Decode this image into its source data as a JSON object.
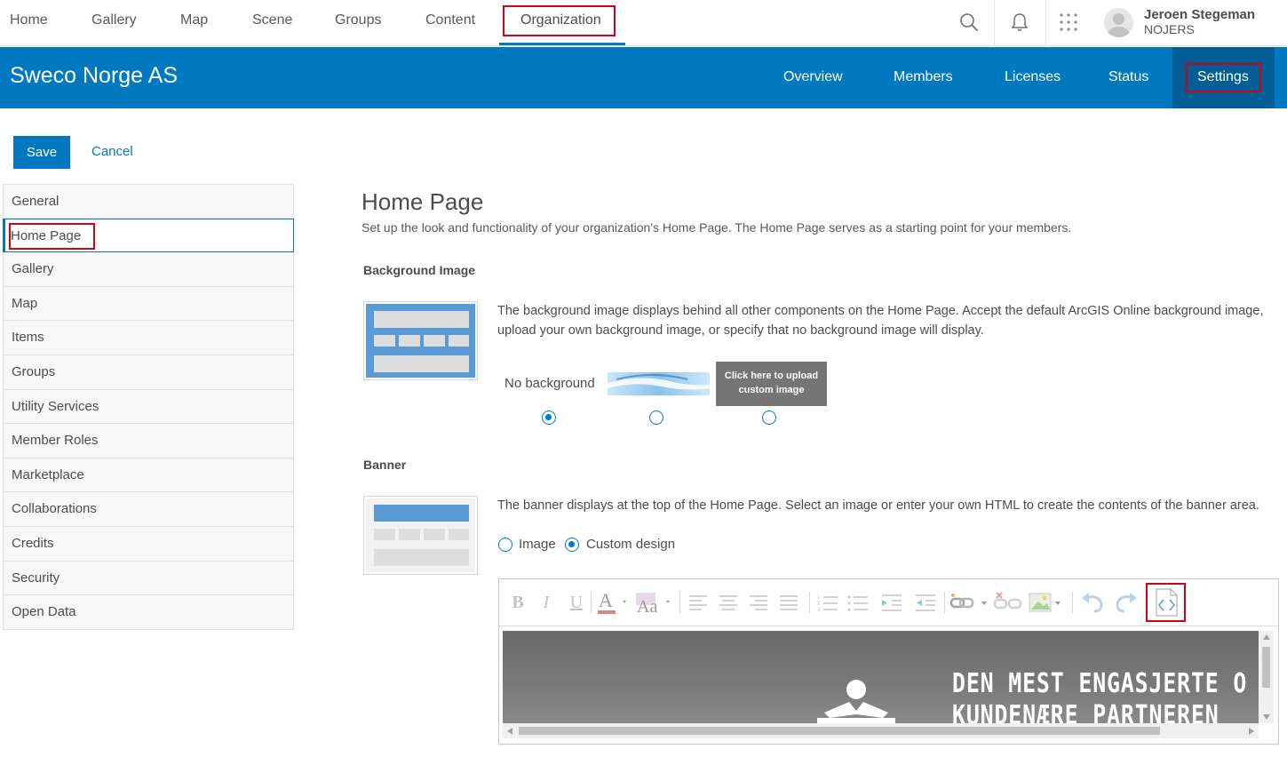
{
  "topnav": {
    "items": [
      "Home",
      "Gallery",
      "Map",
      "Scene",
      "Groups",
      "Content",
      "Organization"
    ],
    "active": "Organization"
  },
  "user": {
    "name": "Jeroen Stegeman",
    "org": "NOJERS"
  },
  "org_header": {
    "name": "Sweco Norge AS",
    "tabs": [
      "Overview",
      "Members",
      "Licenses",
      "Status",
      "Settings"
    ],
    "active_tab": "Settings"
  },
  "actions": {
    "save": "Save",
    "cancel": "Cancel"
  },
  "sidebar": {
    "items": [
      "General",
      "Home Page",
      "Gallery",
      "Map",
      "Items",
      "Groups",
      "Utility Services",
      "Member Roles",
      "Marketplace",
      "Collaborations",
      "Credits",
      "Security",
      "Open Data"
    ],
    "active": "Home Page"
  },
  "main": {
    "title": "Home Page",
    "description": "Set up the look and functionality of your organization's Home Page. The Home Page serves as a starting point for your members.",
    "background": {
      "title": "Background Image",
      "description": "The background image displays behind all other components on the Home Page. Accept the default ArcGIS Online background image, upload your own background image, or specify that no background image will display.",
      "no_background": "No background",
      "upload": "Click here to upload custom image",
      "selected": "No background"
    },
    "banner": {
      "title": "Banner",
      "description": "The banner displays at the top of the Home Page. Select an image or enter your own HTML to create the contents of the banner area.",
      "option_image": "Image",
      "option_custom": "Custom design",
      "selected": "Custom design",
      "preview_text_line1": "DEN MEST ENGASJERTE O",
      "preview_text_line2": "KUNDENÆRE PARTNEREN"
    }
  },
  "colors": {
    "brand_blue": "#0079c1",
    "dark_blue": "#005e95",
    "highlight_red": "#d0021b"
  },
  "toolbar_icons": [
    "bold-icon",
    "italic-icon",
    "underline-icon",
    "font-color-icon",
    "background-color-icon",
    "align-left-icon",
    "align-center-icon",
    "align-right-icon",
    "justify-icon",
    "numbered-list-icon",
    "bullet-list-icon",
    "indent-icon",
    "outdent-icon",
    "link-icon",
    "unlink-icon",
    "image-icon",
    "undo-icon",
    "redo-icon",
    "html-source-icon"
  ]
}
